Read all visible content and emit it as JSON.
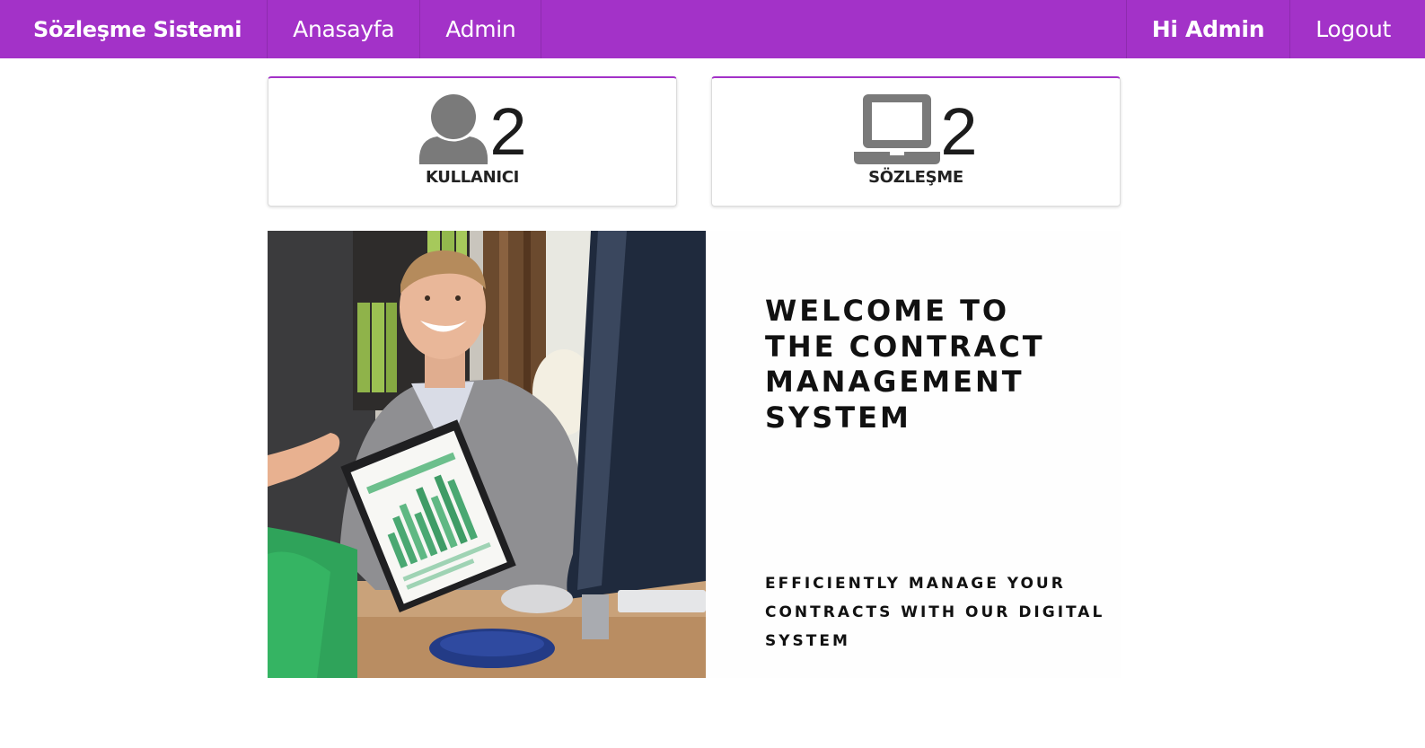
{
  "navbar": {
    "brand": "Sözleşme Sistemi",
    "links": [
      "Anasayfa",
      "Admin"
    ],
    "greeting": "Hi Admin",
    "logout": "Logout",
    "accent_color": "#a332c8"
  },
  "stats": [
    {
      "icon": "user-icon",
      "count": "2",
      "label": "KULLANICI"
    },
    {
      "icon": "laptop-icon",
      "count": "2",
      "label": "SÖZLEŞME"
    }
  ],
  "hero": {
    "title": "WELCOME TO THE CONTRACT MANAGEMENT SYSTEM",
    "subtitle": "EFFICIENTLY MANAGE YOUR CONTRACTS WITH OUR DIGITAL SYSTEM"
  }
}
